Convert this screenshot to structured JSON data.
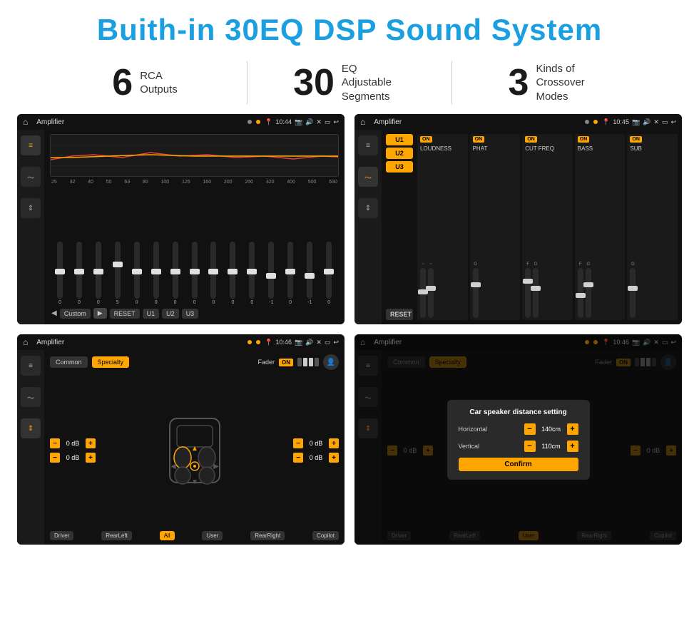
{
  "header": {
    "title": "Buith-in 30EQ DSP Sound System"
  },
  "stats": [
    {
      "num": "6",
      "text": "RCA\nOutputs"
    },
    {
      "num": "30",
      "text": "EQ Adjustable\nSegments"
    },
    {
      "num": "3",
      "text": "Kinds of\nCrossover Modes"
    }
  ],
  "screens": {
    "eq": {
      "title": "Amplifier",
      "time": "10:44",
      "bands": [
        "25",
        "32",
        "40",
        "50",
        "63",
        "80",
        "100",
        "125",
        "160",
        "200",
        "250",
        "320",
        "400",
        "500",
        "630"
      ],
      "values": [
        "0",
        "0",
        "0",
        "5",
        "0",
        "0",
        "0",
        "0",
        "0",
        "0",
        "0",
        "-1",
        "0",
        "-1"
      ],
      "preset_label": "Custom",
      "buttons": [
        "RESET",
        "U1",
        "U2",
        "U3"
      ]
    },
    "crossover": {
      "title": "Amplifier",
      "time": "10:45",
      "presets": [
        "U1",
        "U2",
        "U3"
      ],
      "panels": [
        {
          "label": "LOUDNESS",
          "on": true
        },
        {
          "label": "PHAT",
          "on": true
        },
        {
          "label": "CUT FREQ",
          "on": true
        },
        {
          "label": "BASS",
          "on": true
        },
        {
          "label": "SUB",
          "on": true
        }
      ],
      "reset_label": "RESET"
    },
    "speaker": {
      "title": "Amplifier",
      "time": "10:46",
      "tabs": [
        "Common",
        "Specialty"
      ],
      "active_tab": "Specialty",
      "fader_label": "Fader",
      "fader_on": "ON",
      "volumes": [
        {
          "label": "",
          "val": "0 dB"
        },
        {
          "label": "",
          "val": "0 dB"
        },
        {
          "label": "",
          "val": "0 dB"
        },
        {
          "label": "",
          "val": "0 dB"
        }
      ],
      "footer_btns": [
        "Driver",
        "RearLeft",
        "All",
        "User",
        "RearRight",
        "Copilot"
      ]
    },
    "speaker_dialog": {
      "title": "Amplifier",
      "time": "10:46",
      "tabs": [
        "Common",
        "Specialty"
      ],
      "active_tab": "Specialty",
      "fader_label": "Fader",
      "fader_on": "ON",
      "dialog": {
        "title": "Car speaker distance setting",
        "horizontal_label": "Horizontal",
        "horizontal_val": "140cm",
        "vertical_label": "Vertical",
        "vertical_val": "110cm",
        "confirm_label": "Confirm"
      },
      "volumes": [
        {
          "val": "0 dB"
        },
        {
          "val": "0 dB"
        }
      ],
      "footer_btns": [
        "Driver",
        "RearLeft",
        "User",
        "RearRight",
        "Copilot"
      ]
    }
  },
  "icons": {
    "home": "⌂",
    "back": "↩",
    "pin": "📍",
    "camera": "📷",
    "speaker": "🔊",
    "x": "✕",
    "window": "▭",
    "eq": "≡",
    "wave": "〜",
    "arrows": "⇕",
    "person": "👤",
    "play": "▶",
    "prev": "◀",
    "next": "▶",
    "minus": "−",
    "plus": "+"
  }
}
